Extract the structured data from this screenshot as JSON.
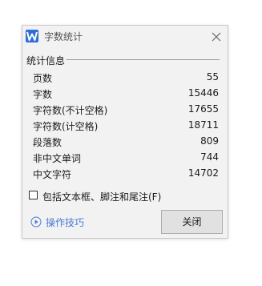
{
  "window": {
    "title": "字数统计"
  },
  "section": {
    "title": "统计信息"
  },
  "stats": [
    {
      "label": "页数",
      "value": "55"
    },
    {
      "label": "字数",
      "value": "15446"
    },
    {
      "label": "字符数(不计空格)",
      "value": "17655"
    },
    {
      "label": "字符数(计空格)",
      "value": "18711"
    },
    {
      "label": "段落数",
      "value": "809"
    },
    {
      "label": "非中文单词",
      "value": "744"
    },
    {
      "label": "中文字符",
      "value": "14702"
    }
  ],
  "options": {
    "include_textbox_label": "包括文本框、脚注和尾注(F)",
    "include_textbox_checked": false
  },
  "footer": {
    "tips_label": "操作技巧",
    "close_label": "关闭"
  },
  "icons": {
    "app": "wps-writer-icon",
    "close": "close-icon",
    "tips": "play-circle-icon"
  },
  "colors": {
    "accent": "#2f6fd8",
    "link": "#4a7bd8"
  }
}
